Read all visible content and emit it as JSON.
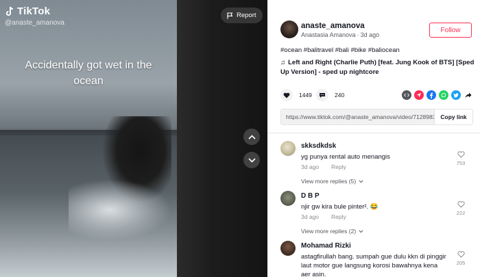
{
  "video": {
    "brand": "TikTok",
    "handle": "@anaste_amanova",
    "caption": "Accidentally got wet in the ocean",
    "report_label": "Report"
  },
  "author": {
    "username": "anaste_amanova",
    "display_name": "Anastasia Amanova",
    "time_ago": "3d ago",
    "follow_label": "Follow"
  },
  "post": {
    "hashtags": "#ocean #balitravel #bali #bike #baliocean",
    "music": "Left and Right (Charlie Puth) [feat. Jung Kook of BTS] [Sped Up Version] - sped up nightcore",
    "likes": "1449",
    "comments": "240",
    "link": "https://www.tiktok.com/@anaste_amanova/video/7128983...",
    "copy_link_label": "Copy link"
  },
  "share_icons": [
    {
      "name": "embed-icon",
      "color": "#55565c"
    },
    {
      "name": "send-icon",
      "color": "#fe2c55"
    },
    {
      "name": "facebook-icon",
      "color": "#1877f2"
    },
    {
      "name": "whatsapp-icon",
      "color": "#25d366"
    },
    {
      "name": "twitter-icon",
      "color": "#1da1f2"
    },
    {
      "name": "share-arrow-icon",
      "color": "#161823"
    }
  ],
  "comments": [
    {
      "user": "skksdkdsk",
      "text": "yg punya rental auto menangis",
      "time": "3d ago",
      "reply_label": "Reply",
      "likes": "753",
      "view_replies": "View more replies (5)"
    },
    {
      "user": "D B P",
      "text": "njir gw kira bule pinter². 😂",
      "time": "3d ago",
      "reply_label": "Reply",
      "likes": "222",
      "view_replies": "View more replies (2)"
    },
    {
      "user": "Mohamad Rizki",
      "text": "astagfirullah bang. sumpah gue dulu kkn di pinggir laut motor gue langsung korosi bawahnya kena aer asin.",
      "likes": "205"
    }
  ],
  "colors": {
    "accent": "#fe2c55",
    "text": "#161823",
    "muted": "#8a8b91"
  }
}
